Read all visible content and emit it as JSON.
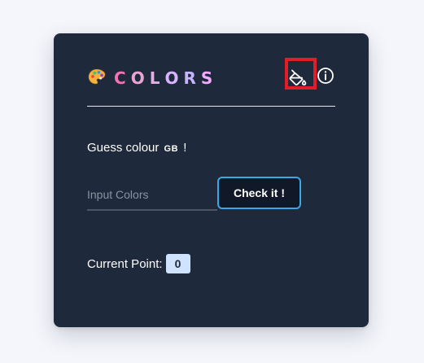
{
  "header": {
    "logo_icon": "palette-icon",
    "title_letters": [
      "C",
      "O",
      "L",
      "O",
      "R",
      "S"
    ],
    "title_colors": [
      "#f472b6",
      "#e9a3d6",
      "#e1b0e8",
      "#d8b4fe",
      "#c4b5fd",
      "#f0abfc"
    ],
    "theme_icon": "paint-bucket-icon",
    "info_icon": "info-icon"
  },
  "game": {
    "prompt_text": "Guess colour",
    "prompt_code": "GB",
    "prompt_suffix": "!",
    "input_placeholder": "Input Colors",
    "input_value": "",
    "check_button_label": "Check it !",
    "points_label": "Current Point:",
    "points_value": "0"
  },
  "colors": {
    "card_bg": "#1e293b",
    "page_bg": "#f4f6fb",
    "button_border": "#38a9e6",
    "badge_bg": "#cfe3ff",
    "highlight": "#e11d2a"
  }
}
